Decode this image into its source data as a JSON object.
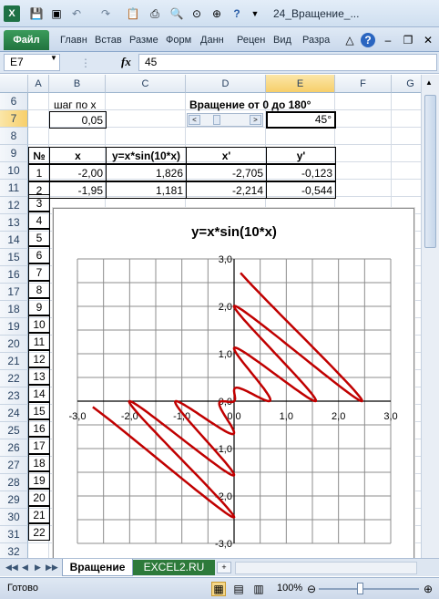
{
  "window": {
    "title": "24_Вращение_..."
  },
  "ribbon": {
    "file_label": "Файл",
    "tabs": [
      "Главн",
      "Встав",
      "Разме",
      "Форм",
      "Данн",
      "Рецен",
      "Вид",
      "Разра"
    ]
  },
  "formula_bar": {
    "name_box": "E7",
    "fx_label": "fx",
    "value": "45"
  },
  "columns": [
    "A",
    "B",
    "C",
    "D",
    "E",
    "F",
    "G"
  ],
  "rows": [
    "6",
    "7",
    "8",
    "9",
    "10",
    "11",
    "12",
    "13",
    "14",
    "15",
    "16",
    "17",
    "18",
    "19",
    "20",
    "21",
    "22",
    "23",
    "24",
    "25",
    "26",
    "27",
    "28",
    "29",
    "30",
    "31",
    "32"
  ],
  "sheet": {
    "step_label": "шаг по x",
    "step_value": "0,05",
    "rotation_label": "Вращение от 0 до 180°",
    "rotation_value": "45°",
    "headers": {
      "no": "№",
      "x": "x",
      "y": "y=x*sin(10*x)",
      "xp": "x'",
      "yp": "y'"
    },
    "row_numbers": [
      "1",
      "2",
      "3",
      "4",
      "5",
      "6",
      "7",
      "8",
      "9",
      "10",
      "11",
      "12",
      "13",
      "14",
      "15",
      "16",
      "17",
      "18",
      "19",
      "20",
      "21",
      "22"
    ],
    "data_rows": [
      {
        "no": "1",
        "x": "-2,00",
        "y": "1,826",
        "xp": "-2,705",
        "yp": "-0,123"
      },
      {
        "no": "2",
        "x": "-1,95",
        "y": "1,181",
        "xp": "-2,214",
        "yp": "-0,544"
      }
    ]
  },
  "tabs": {
    "active": "Вращение",
    "other": "EXCEL2.RU"
  },
  "status": {
    "ready": "Готово",
    "zoom": "100%"
  },
  "colors": {
    "series": "#c00000",
    "excel_green": "#1e7145",
    "selection": "#f7cf6a"
  },
  "chart_data": {
    "type": "line",
    "title": "y=x*sin(10*x)",
    "xlabel": "",
    "ylabel": "",
    "xlim": [
      -3,
      3
    ],
    "ylim": [
      -3,
      3
    ],
    "x_ticks": [
      "-3,0",
      "-2,0",
      "-1,0",
      "0,0",
      "1,0",
      "2,0",
      "3,0"
    ],
    "y_ticks": [
      "3,0",
      "2,0",
      "1,0",
      "0,0",
      "-1,0",
      "-2,0",
      "-3,0"
    ],
    "grid": true,
    "legend": "none",
    "series": [
      {
        "rotation_deg": 45,
        "x_step": 0.05,
        "x_range": [
          -2,
          2
        ],
        "x": [
          -2.705,
          -2.214
        ],
        "y": [
          -0.123,
          -0.544
        ]
      }
    ]
  }
}
